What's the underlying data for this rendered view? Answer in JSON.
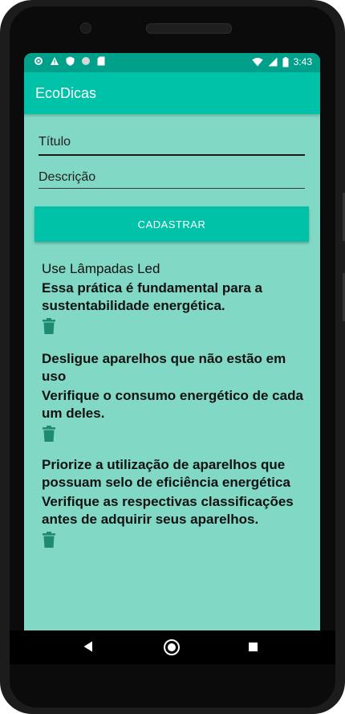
{
  "status_bar": {
    "time": "3:43",
    "left_icons": [
      "gear-icon",
      "warning-icon",
      "shield-icon",
      "circle-icon",
      "sd-card-icon"
    ],
    "right_icons": [
      "wifi-icon",
      "signal-icon",
      "battery-icon"
    ]
  },
  "app_bar": {
    "title": "EcoDicas"
  },
  "form": {
    "title_placeholder": "Título",
    "description_placeholder": "Descrição",
    "submit_label": "CADASTRAR"
  },
  "tips": [
    {
      "title": "Use Lâmpadas Led",
      "description": "Essa prática é fundamental para a sustentabilidade energética.",
      "delete_icon": "trash-icon"
    },
    {
      "title": "Desligue aparelhos que não estão em uso",
      "description": "Verifique o consumo energético de cada um deles.",
      "delete_icon": "trash-icon"
    },
    {
      "title": "Priorize a utilização de aparelhos que possuam selo de eficiência energética",
      "description": "Verifique as respectivas classificações antes de adquirir seus aparelhos.",
      "delete_icon": "trash-icon"
    }
  ],
  "colors": {
    "app_bar": "#00c2a8",
    "status_bar": "#00a08b",
    "background": "#80d8c5",
    "trash_icon": "#1e8a72"
  },
  "nav_bar": {
    "icons": [
      "back-icon",
      "home-icon",
      "recents-icon"
    ]
  }
}
